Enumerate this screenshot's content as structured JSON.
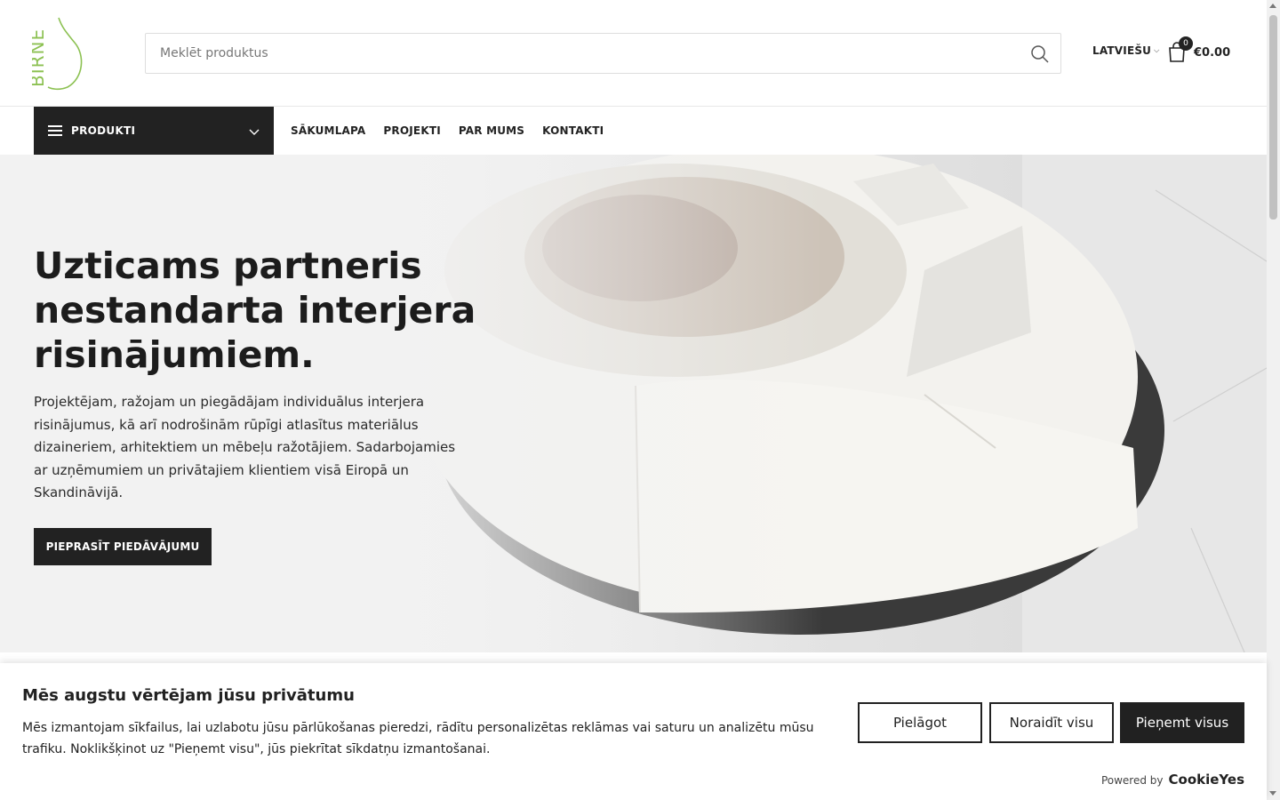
{
  "header": {
    "logo_text": "BIRNE",
    "search_placeholder": "Meklēt produktus",
    "language": "LATVIEŠU",
    "cart_count": "0",
    "cart_total": "€0.00"
  },
  "nav": {
    "categories_label": "PRODUKTI",
    "items": [
      {
        "label": "SĀKUMLAPA"
      },
      {
        "label": "PROJEKTI"
      },
      {
        "label": "PAR MUMS"
      },
      {
        "label": "KONTAKTI"
      }
    ]
  },
  "hero": {
    "title": "Uzticams partneris nestandarta interjera risinājumiem.",
    "text": "Projektējam, ražojam un piegādājam individuālus interjera risinājumus, kā arī nodrošinām rūpīgi atlasītus materiālus dizaineriem, arhitektiem un mēbeļu ražotājiem. Sadarbojamies ar uzņēmumiem un privātajiem klientiem visā Eiropā un Skandināvijā.",
    "cta": "PIEPRASĪT PIEDĀVĀJUMU"
  },
  "cookie": {
    "title": "Mēs augstu vērtējam jūsu privātumu",
    "text": "Mēs izmantojam sīkfailus, lai uzlabotu jūsu pārlūkošanas pieredzi, rādītu personalizētas reklāmas vai saturu un analizētu mūsu trafiku. Noklikšķinot uz \"Pieņemt visu\", jūs piekrītat sīkdatņu izmantošanai.",
    "customize": "Pielāgot",
    "reject": "Noraidīt visu",
    "accept": "Pieņemt visus",
    "powered_by": "Powered by",
    "brand": "CookieYes"
  },
  "colors": {
    "logo_green": "#8cc152",
    "dark": "#222222"
  }
}
